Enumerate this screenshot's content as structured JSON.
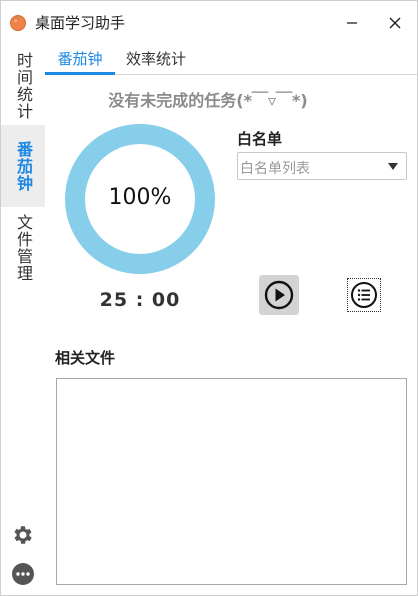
{
  "window": {
    "title": "桌面学习助手",
    "minimize_label": "—",
    "close_label": "✕"
  },
  "sidebar": {
    "tabs": [
      {
        "label": "时间统计"
      },
      {
        "label": "番茄钟"
      },
      {
        "label": "文件管理"
      }
    ],
    "active_index": 1
  },
  "top_tabs": [
    {
      "label": "番茄钟"
    },
    {
      "label": "效率统计"
    }
  ],
  "task_message": "没有未完成的任务(*￣▿￣*)",
  "progress": {
    "percent_label": "100%",
    "fraction": 1.0
  },
  "timer": "25 : 00",
  "whitelist": {
    "label": "白名单",
    "placeholder": "白名单列表"
  },
  "related_files": {
    "label": "相关文件"
  },
  "colors": {
    "accent": "#1e88e5",
    "ring": "#87ceeb",
    "active_tab_bg": "#ededed"
  }
}
